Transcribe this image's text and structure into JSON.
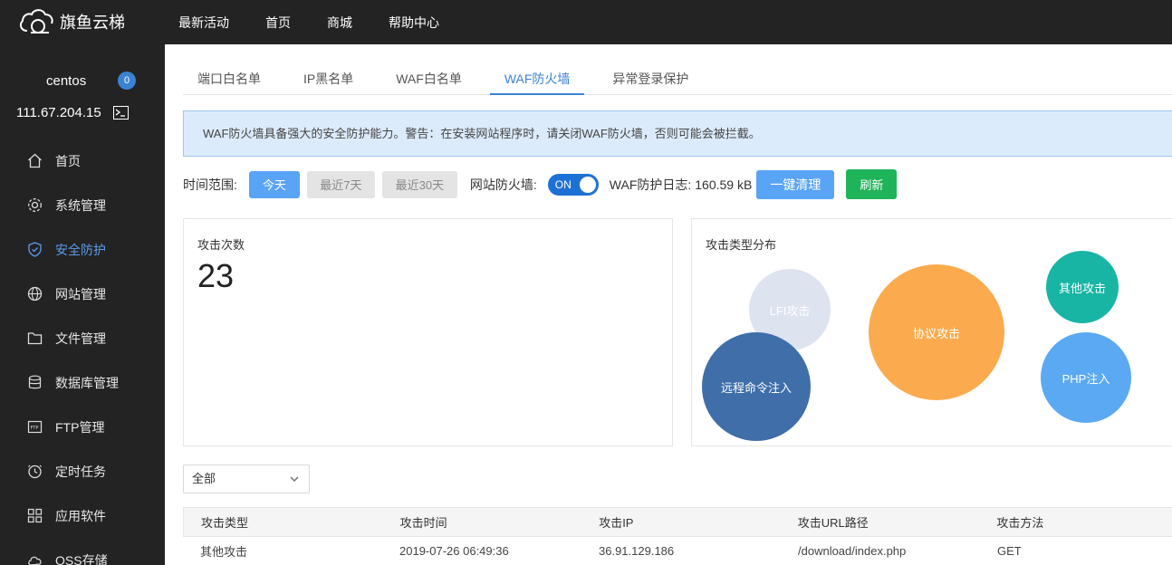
{
  "brand": {
    "name": "旗鱼云梯"
  },
  "topnav": [
    "最新活动",
    "首页",
    "商城",
    "帮助中心"
  ],
  "sidebar": {
    "user": "centos",
    "badge": "0",
    "ip": "111.67.204.15",
    "items": [
      {
        "label": "首页",
        "icon": "home-icon"
      },
      {
        "label": "系统管理",
        "icon": "gear-icon"
      },
      {
        "label": "安全防护",
        "icon": "shield-icon",
        "active": true
      },
      {
        "label": "网站管理",
        "icon": "globe-icon"
      },
      {
        "label": "文件管理",
        "icon": "folder-icon"
      },
      {
        "label": "数据库管理",
        "icon": "database-icon"
      },
      {
        "label": "FTP管理",
        "icon": "ftp-icon"
      },
      {
        "label": "定时任务",
        "icon": "clock-icon"
      },
      {
        "label": "应用软件",
        "icon": "apps-icon"
      },
      {
        "label": "OSS存储",
        "icon": "cloud-icon"
      }
    ]
  },
  "tabs": [
    "端口白名单",
    "IP黑名单",
    "WAF白名单",
    "WAF防火墙",
    "异常登录保护"
  ],
  "notice": "WAF防火墙具备强大的安全防护能力。警告：在安装网站程序时，请关闭WAF防火墙，否则可能会被拦截。",
  "toolbar": {
    "time_range_label": "时间范围:",
    "today": "今天",
    "last7": "最近7天",
    "last30": "最近30天",
    "firewall_label": "网站防火墙:",
    "toggle": "ON",
    "log_label": "WAF防护日志:",
    "log_size": "160.59 kB",
    "clear_btn": "一键清理",
    "refresh_btn": "刷新"
  },
  "stats": {
    "title": "攻击次数",
    "count": "23"
  },
  "distribution": {
    "title": "攻击类型分布",
    "bubbles": [
      "LFI攻击",
      "协议攻击",
      "其他攻击",
      "远程命令注入",
      "PHP注入"
    ],
    "colors": [
      "#dde3ef",
      "#fbab4d",
      "#18b5a5",
      "#3f6ea9",
      "#5aa9f2"
    ]
  },
  "filter": {
    "selected": "全部"
  },
  "table": {
    "headers": [
      "攻击类型",
      "攻击时间",
      "攻击IP",
      "攻击URL路径",
      "攻击方法"
    ],
    "rows": [
      [
        "其他攻击",
        "2019-07-26 06:49:36",
        "36.91.129.186",
        "/download/index.php",
        "GET"
      ]
    ]
  }
}
